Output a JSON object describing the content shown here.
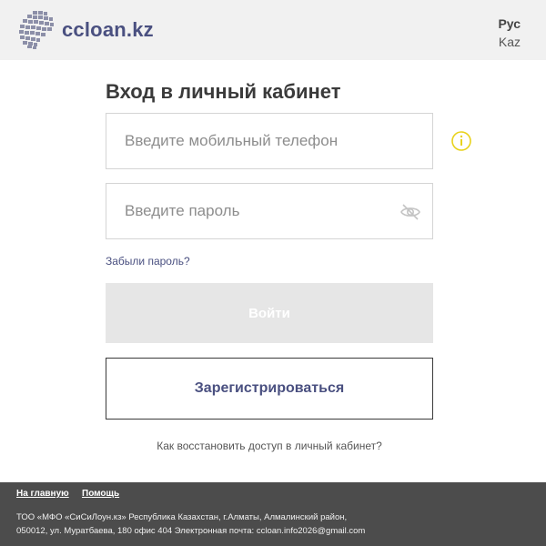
{
  "header": {
    "logo_icon": "globe-grid-logo",
    "logo_text": "ccloan.kz",
    "brand_color": "#4a5080",
    "languages": [
      "Рус",
      "Kaz"
    ]
  },
  "login": {
    "title": "Вход в личный кабинет",
    "phone_placeholder": "Введите мобильный телефон",
    "phone_value": "",
    "phone_info_icon": "info-icon",
    "password_placeholder": "Введите пароль",
    "password_value": "",
    "password_toggle_icon": "eye-off-icon",
    "forgot_label": "Забыли пароль?",
    "login_label": "Войти",
    "login_disabled": true,
    "register_label": "Зарегистрироваться",
    "restore_label": "Как восстановить доступ в личный кабинет?",
    "info_icon_color": "#e8d21c"
  },
  "footer": {
    "links": [
      "На главную",
      "Помощь"
    ],
    "address_line_1": "ТОО «МФО «СиСиЛоун.кз» Республика Казахстан, г.Алматы, Алмалинский район,",
    "address_line_2": "050012, ул. Муратбаева, 180 офис 404 Электронная почта: ccloan.info2026@gmail.com",
    "background": "#4c4c4c"
  }
}
